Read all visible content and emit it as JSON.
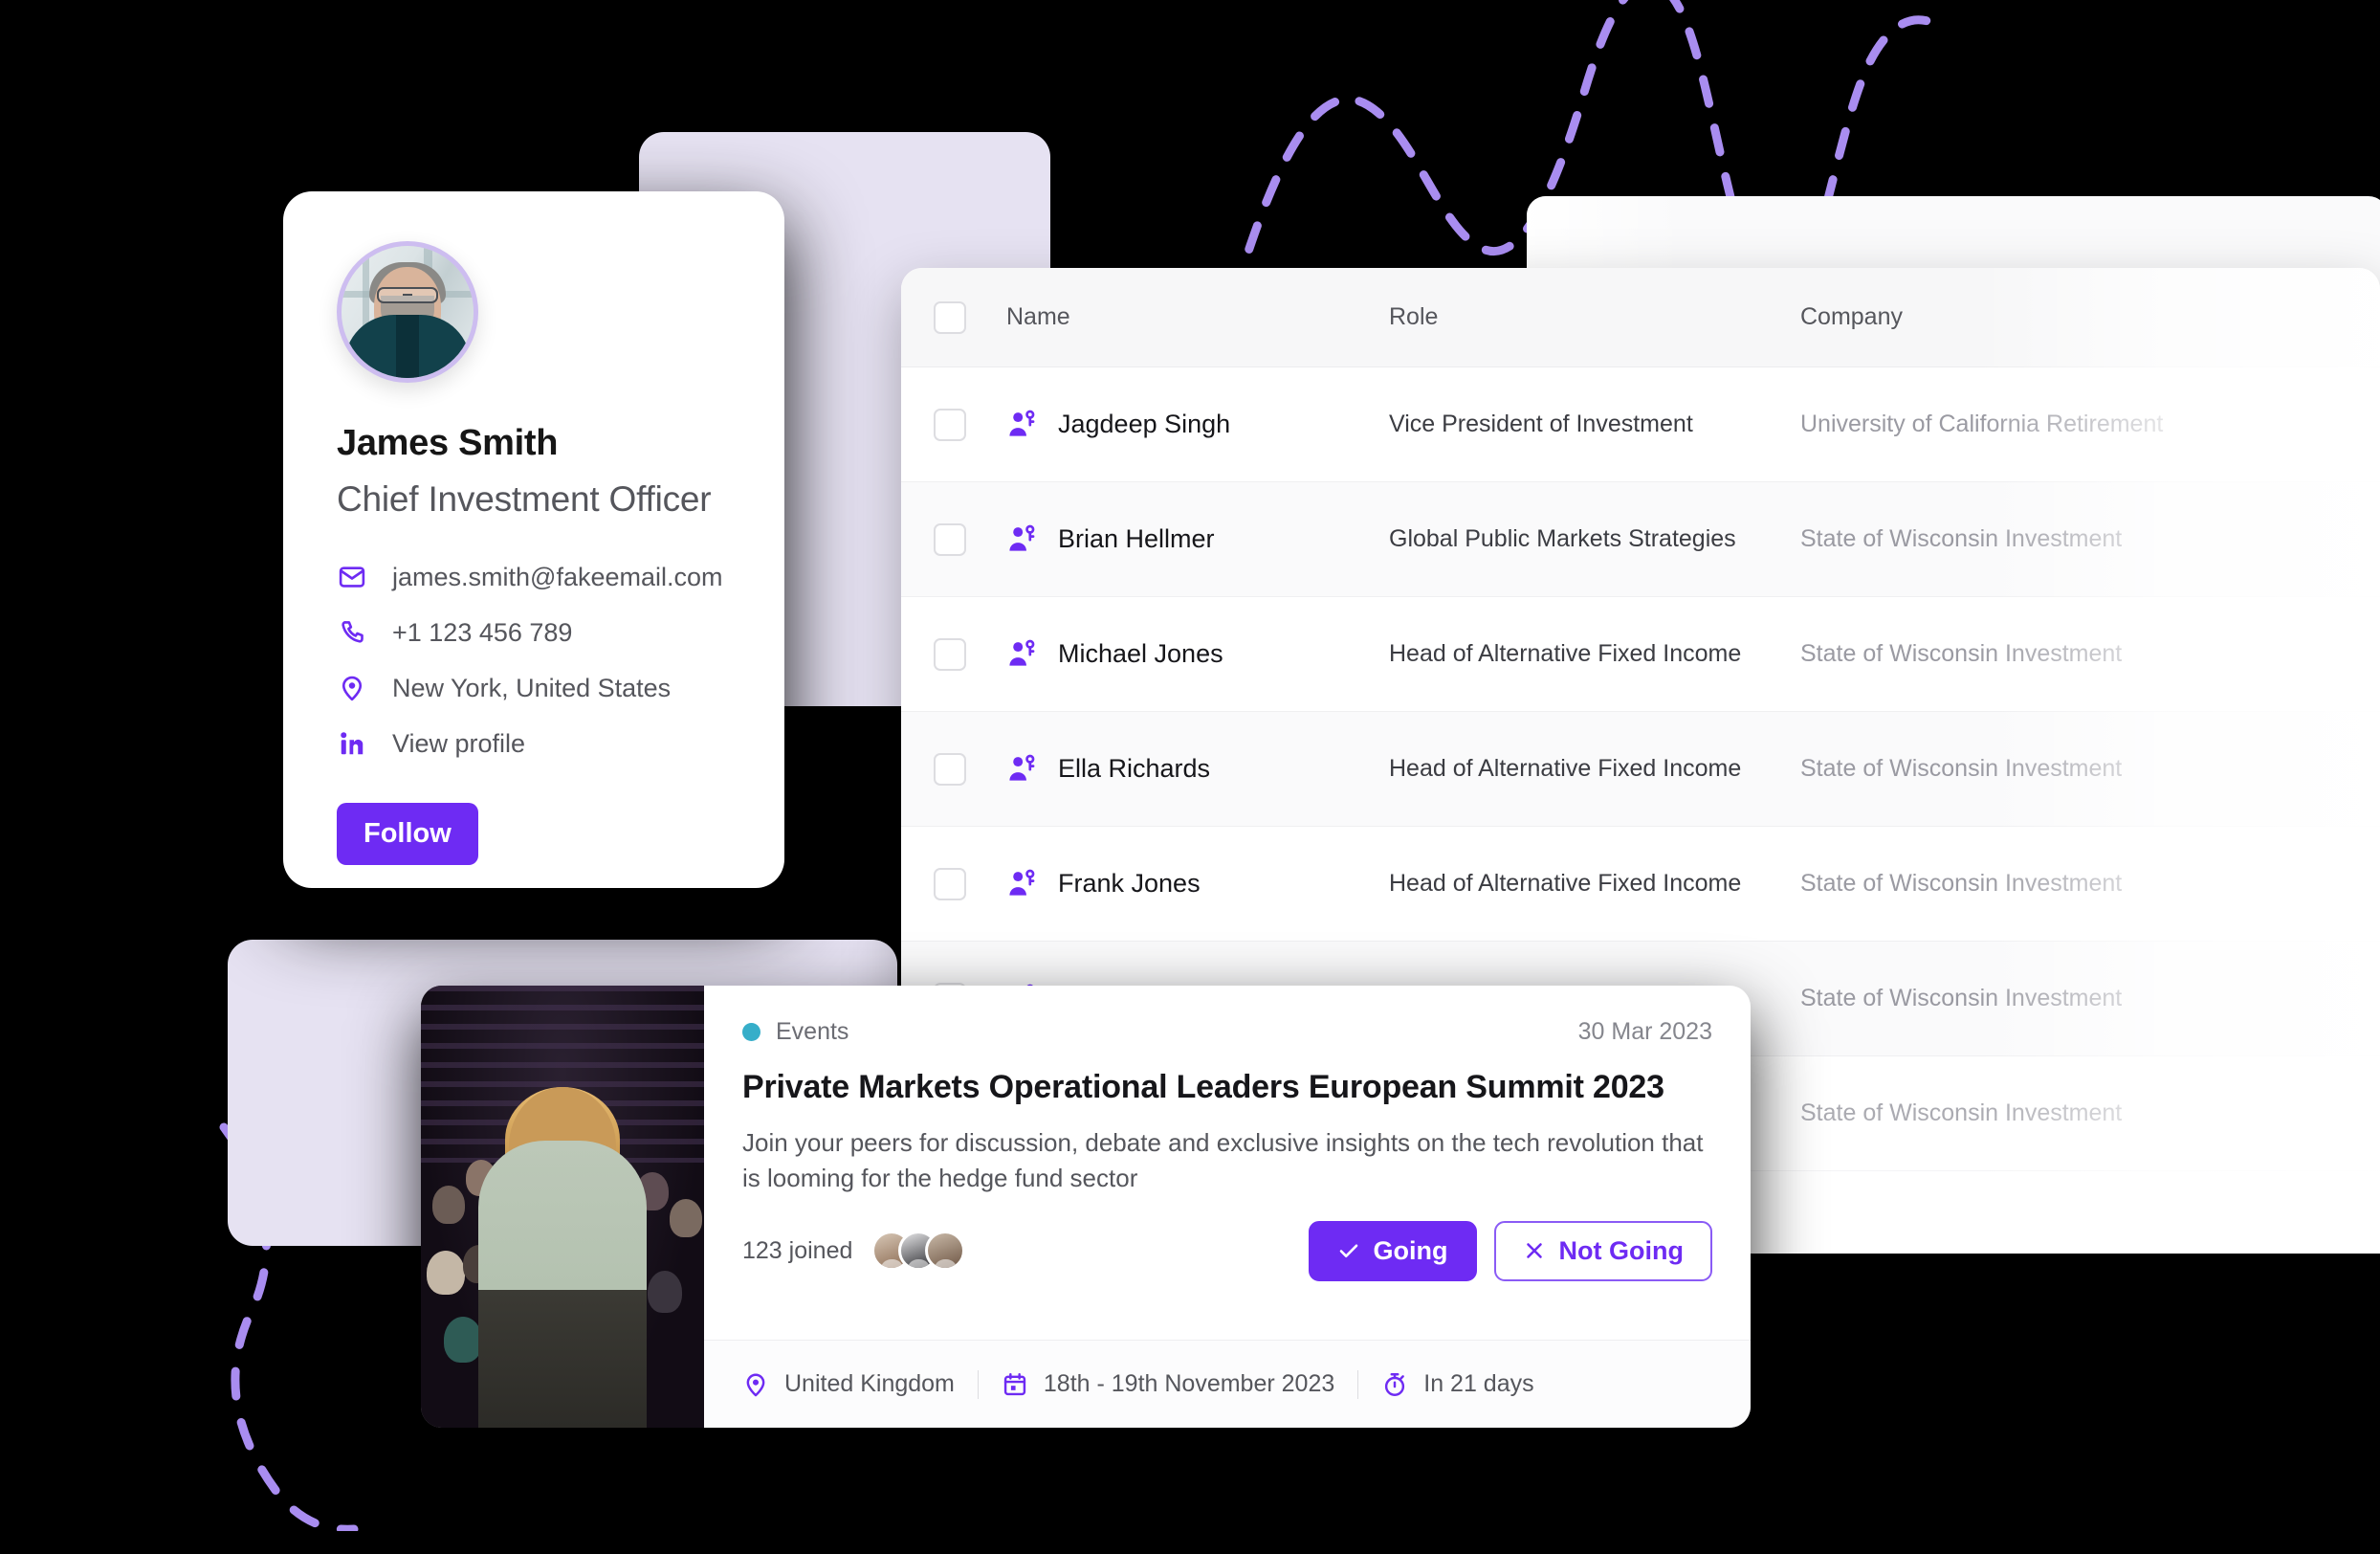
{
  "theme": {
    "background": "#000000",
    "accent_purple": "#6E2BF3",
    "accent_purple_light": "#8A5BF5",
    "lavender_panel": "#E6E2F2",
    "events_dot_teal": "#36AEC9",
    "avatar_ring": "#CDBDF0"
  },
  "profile": {
    "name": "James Smith",
    "role": "Chief Investment Officer",
    "contacts": [
      {
        "icon": "mail-icon",
        "text": "james.smith@fakeemail.com"
      },
      {
        "icon": "phone-icon",
        "text": "+1 123 456 789"
      },
      {
        "icon": "location-pin-icon",
        "text": "New York, United States"
      },
      {
        "icon": "linkedin-icon",
        "text": "View profile"
      }
    ],
    "follow_label": "Follow"
  },
  "table": {
    "columns": [
      "Name",
      "Role",
      "Company"
    ],
    "rows": [
      {
        "name": "Jagdeep Singh",
        "role": "Vice President of Investment",
        "company": "University of California Retirement"
      },
      {
        "name": "Brian Hellmer",
        "role": "Global Public Markets Strategies",
        "company": "State of Wisconsin Investment"
      },
      {
        "name": "Michael Jones",
        "role": "Head of Alternative Fixed Income",
        "company": "State of Wisconsin Investment"
      },
      {
        "name": "Ella Richards",
        "role": "Head of Alternative Fixed Income",
        "company": "State of Wisconsin Investment"
      },
      {
        "name": "Frank Jones",
        "role": "Head of Alternative Fixed Income",
        "company": "State of Wisconsin Investment"
      },
      {
        "name": "",
        "role": "",
        "company": "State of Wisconsin Investment"
      },
      {
        "name": "",
        "role": "",
        "company": "State of Wisconsin Investment"
      }
    ]
  },
  "event": {
    "tag": "Events",
    "posted_date": "30 Mar 2023",
    "title": "Private Markets Operational Leaders European Summit 2023",
    "description": "Join your peers for discussion, debate and exclusive insights on the tech revolution that is looming for the hedge fund sector",
    "joined_label": "123 joined",
    "going_label": "Going",
    "not_going_label": "Not Going",
    "footer": {
      "location": "United Kingdom",
      "dates": "18th - 19th November 2023",
      "countdown": "In 21 days"
    }
  }
}
